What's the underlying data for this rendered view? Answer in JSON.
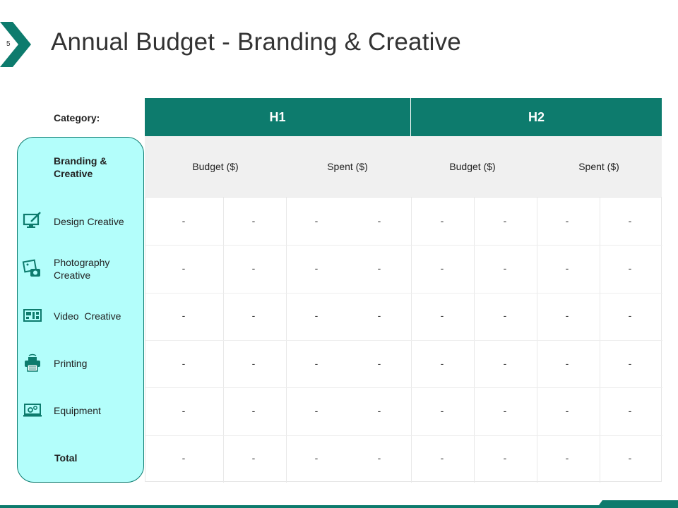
{
  "slide": {
    "number": "5",
    "title": "Annual Budget - Branding & Creative"
  },
  "table": {
    "category_header": "Category:",
    "periods": [
      "H1",
      "H2"
    ],
    "sub_headers": [
      "Budget ($)",
      "Spent ($)",
      "Budget ($)",
      "Spent ($)"
    ],
    "group_label": "Branding & Creative",
    "rows": [
      {
        "label": "Design Creative",
        "icon": "monitor-pen-icon",
        "values": [
          "-",
          "-",
          "-",
          "-",
          "-",
          "-",
          "-",
          "-"
        ]
      },
      {
        "label": "Photography Creative",
        "icon": "photo-camera-icon",
        "values": [
          "-",
          "-",
          "-",
          "-",
          "-",
          "-",
          "-",
          "-"
        ]
      },
      {
        "label": "Video  Creative",
        "icon": "video-film-icon",
        "values": [
          "-",
          "-",
          "-",
          "-",
          "-",
          "-",
          "-",
          "-"
        ]
      },
      {
        "label": "Printing",
        "icon": "printer-icon",
        "values": [
          "-",
          "-",
          "-",
          "-",
          "-",
          "-",
          "-",
          "-"
        ]
      },
      {
        "label": "Equipment",
        "icon": "laptop-gear-icon",
        "values": [
          "-",
          "-",
          "-",
          "-",
          "-",
          "-",
          "-",
          "-"
        ]
      },
      {
        "label": "Total",
        "icon": "",
        "values": [
          "-",
          "-",
          "-",
          "-",
          "-",
          "-",
          "-",
          "-"
        ]
      }
    ]
  },
  "colors": {
    "accent": "#0d7b6d",
    "panel": "#b3fefb",
    "subheader_bg": "#f0f0f0"
  }
}
